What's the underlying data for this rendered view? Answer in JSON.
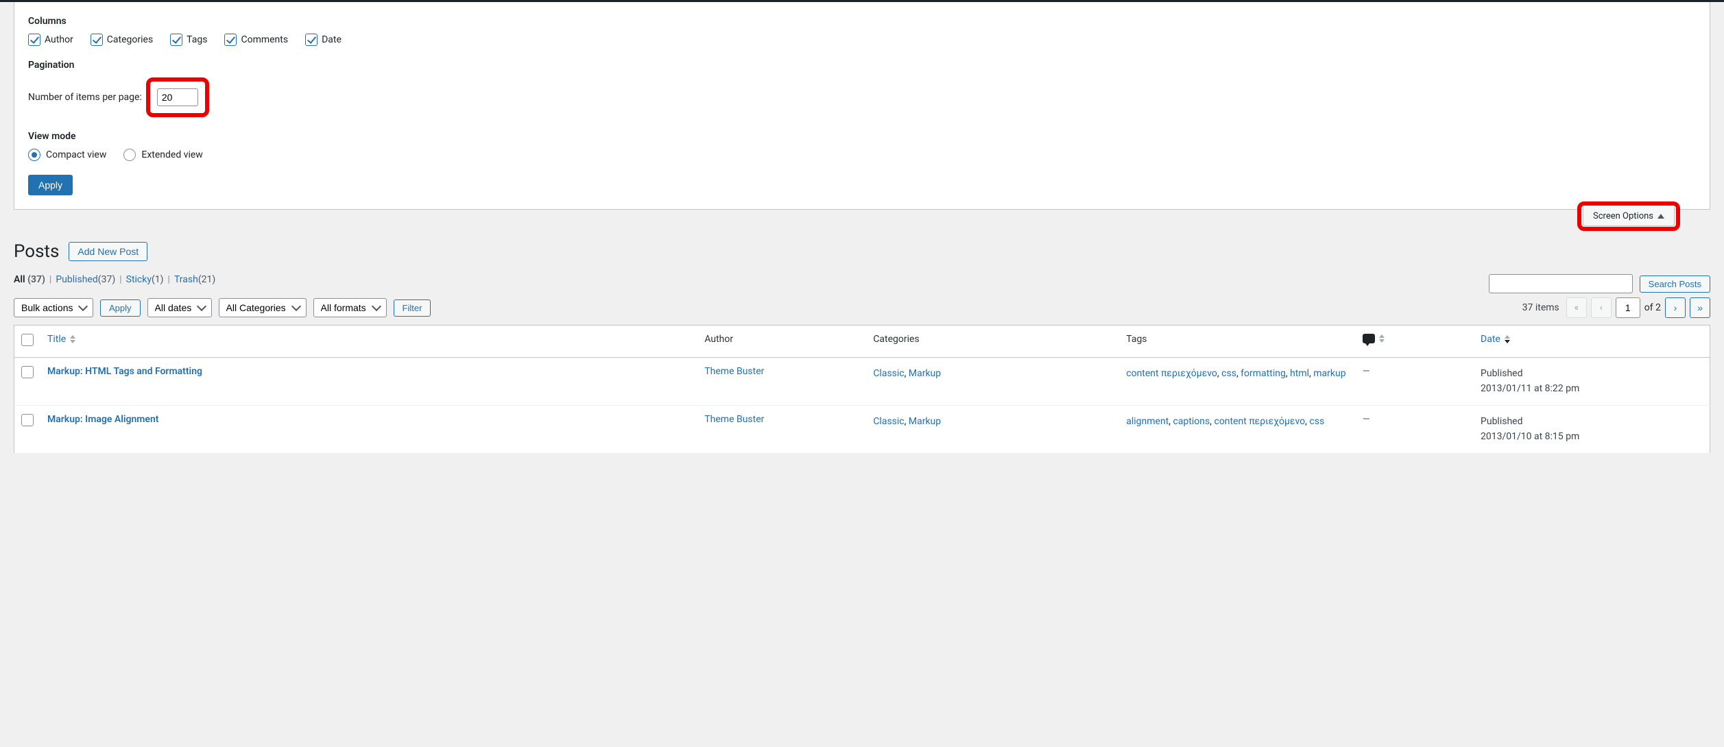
{
  "screen_options": {
    "columns_heading": "Columns",
    "columns": [
      {
        "key": "author",
        "label": "Author",
        "checked": true
      },
      {
        "key": "categories",
        "label": "Categories",
        "checked": true
      },
      {
        "key": "tags",
        "label": "Tags",
        "checked": true
      },
      {
        "key": "comments",
        "label": "Comments",
        "checked": true
      },
      {
        "key": "date",
        "label": "Date",
        "checked": true
      }
    ],
    "pagination_heading": "Pagination",
    "per_page_label": "Number of items per page:",
    "per_page_value": "20",
    "view_mode_heading": "View mode",
    "view_compact_label": "Compact view",
    "view_extended_label": "Extended view",
    "view_mode_selected": "compact",
    "apply_label": "Apply",
    "tab_label": "Screen Options"
  },
  "page": {
    "heading": "Posts",
    "add_new_label": "Add New Post",
    "search_button": "Search Posts"
  },
  "filters": {
    "all_label": "All",
    "all_count": "(37)",
    "published_label": "Published",
    "published_count": "(37)",
    "sticky_label": "Sticky",
    "sticky_count": "(1)",
    "trash_label": "Trash",
    "trash_count": "(21)"
  },
  "tablenav": {
    "bulk_actions": "Bulk actions",
    "bulk_apply": "Apply",
    "dates": "All dates",
    "categories": "All Categories",
    "formats": "All formats",
    "filter": "Filter",
    "items_count": "37 items",
    "current_page": "1",
    "total_pages": "2",
    "of_label": "of"
  },
  "columns_header": {
    "title": "Title",
    "author": "Author",
    "categories": "Categories",
    "tags": "Tags",
    "date": "Date"
  },
  "rows": [
    {
      "title": "Markup: HTML Tags and Formatting",
      "author": "Theme Buster",
      "categories": [
        "Classic",
        "Markup"
      ],
      "tags": [
        "content περιεχόμενο",
        "css",
        "formatting",
        "html",
        "markup"
      ],
      "comments": "—",
      "status": "Published",
      "date": "2013/01/11 at 8:22 pm"
    },
    {
      "title": "Markup: Image Alignment",
      "author": "Theme Buster",
      "categories": [
        "Classic",
        "Markup"
      ],
      "tags": [
        "alignment",
        "captions",
        "content περιεχόμενο",
        "css"
      ],
      "comments": "—",
      "status": "Published",
      "date": "2013/01/10 at 8:15 pm"
    }
  ]
}
